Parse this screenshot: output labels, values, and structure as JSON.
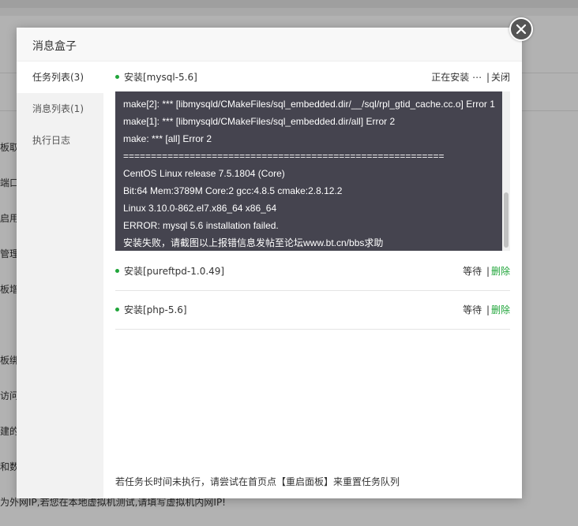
{
  "background": {
    "fragments": [
      "板取",
      "端口",
      "启用",
      "管理",
      "板增",
      "板绑",
      "访问",
      "建的",
      "和数"
    ],
    "bottom_text": "为外网IP,若您在本地虚拟机测试,请填写虚拟机内网IP!"
  },
  "dialog": {
    "title": "消息盒子",
    "close_icon": "close-icon"
  },
  "sidebar": {
    "items": [
      {
        "label": "任务列表(3)",
        "active": true
      },
      {
        "label": "消息列表(1)",
        "active": false
      },
      {
        "label": "执行日志",
        "active": false
      }
    ]
  },
  "tasks": [
    {
      "name": "安装[mysql-5.6]",
      "status": "正在安装 ⋯",
      "separator": "|",
      "action": "关闭",
      "log": [
        "make[2]: *** [libmysqld/CMakeFiles/sql_embedded.dir/__/sql/rpl_gtid_cache.cc.o] Error 1",
        "make[1]: *** [libmysqld/CMakeFiles/sql_embedded.dir/all] Error 2",
        "make: *** [all] Error 2",
        "==========================================================",
        "CentOS Linux release 7.5.1804 (Core)",
        "Bit:64 Mem:3789M Core:2 gcc:4.8.5 cmake:2.8.12.2",
        "Linux 3.10.0-862.el7.x86_64 x86_64",
        "ERROR: mysql 5.6 installation failed.",
        "安装失败，请截图以上报错信息发帖至论坛www.bt.cn/bbs求助"
      ]
    },
    {
      "name": "安装[pureftpd-1.0.49]",
      "status": "等待",
      "separator": "|",
      "action": "删除"
    },
    {
      "name": "安装[php-5.6]",
      "status": "等待",
      "separator": "|",
      "action": "删除"
    }
  ],
  "footer_note": "若任务长时间未执行，请尝试在首页点【重启面板】来重置任务队列",
  "colors": {
    "accent_green": "#20a53a",
    "console_bg": "#45444f"
  }
}
